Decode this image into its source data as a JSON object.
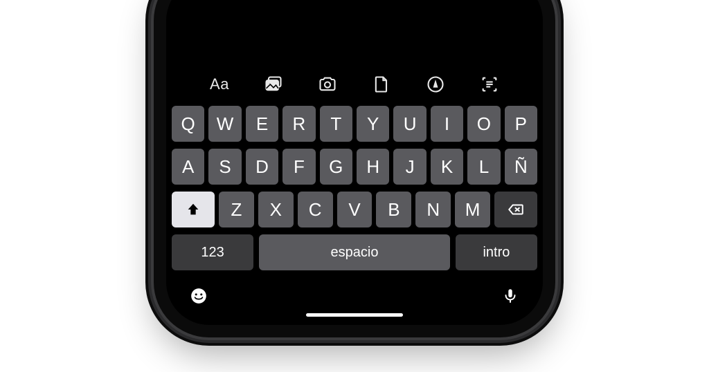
{
  "toolbar": {
    "text_format_label": "Aa"
  },
  "keyboard": {
    "row1": [
      "Q",
      "W",
      "E",
      "R",
      "T",
      "Y",
      "U",
      "I",
      "O",
      "P"
    ],
    "row2": [
      "A",
      "S",
      "D",
      "F",
      "G",
      "H",
      "J",
      "K",
      "L",
      "Ñ"
    ],
    "row3": [
      "Z",
      "X",
      "C",
      "V",
      "B",
      "N",
      "M"
    ],
    "numbers_key": "123",
    "space_key": "espacio",
    "return_key": "intro"
  }
}
